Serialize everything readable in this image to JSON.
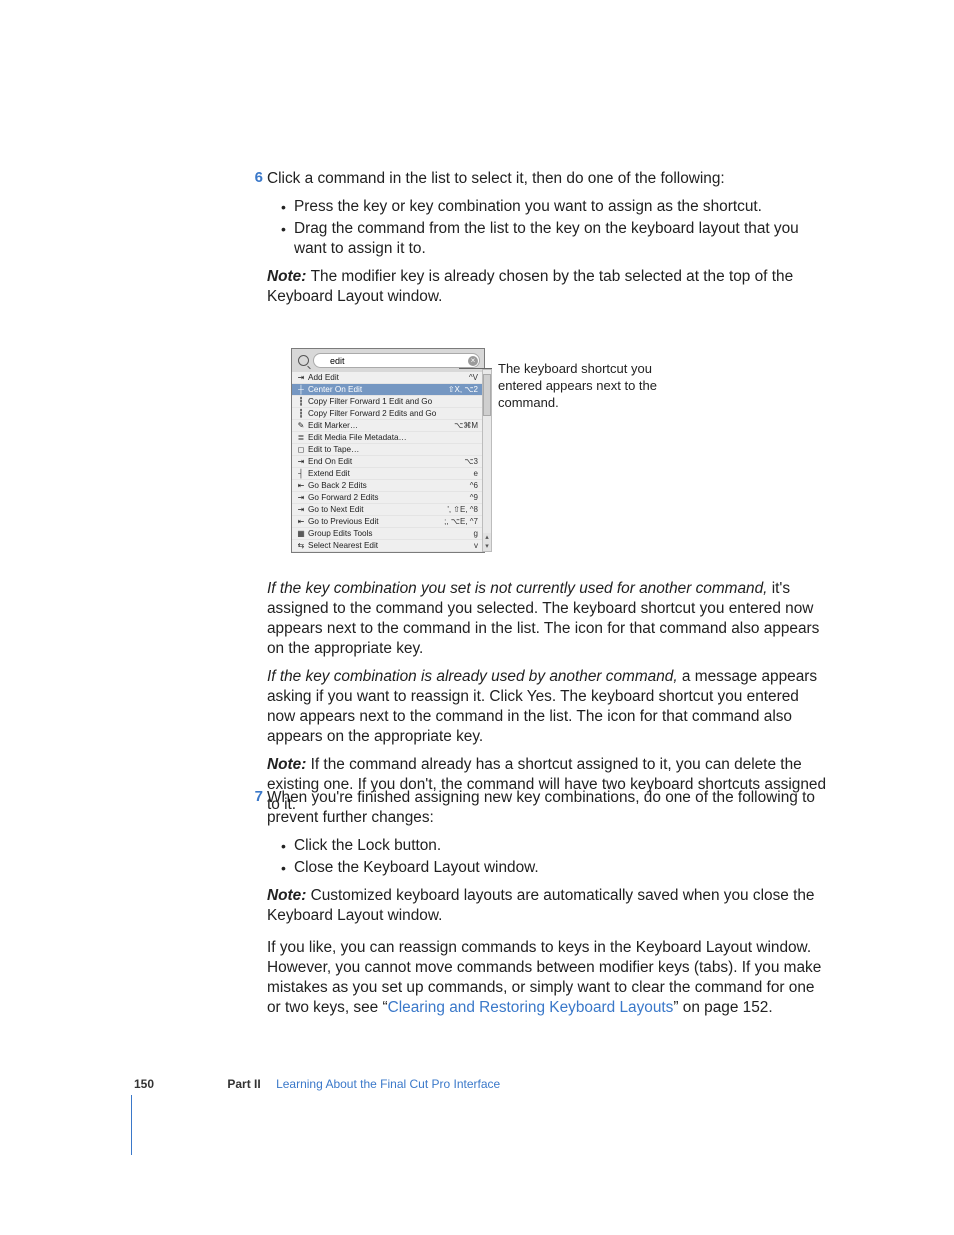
{
  "steps": {
    "s6": {
      "num": "6",
      "lead": "Click a command in the list to select it, then do one of the following:",
      "b1": "Press the key or key combination you want to assign as the shortcut.",
      "b2": "Drag the command from the list to the key on the keyboard layout that you want to assign it to.",
      "note": "The modifier key is already chosen by the tab selected at the top of the Keyboard Layout window."
    },
    "s7": {
      "num": "7",
      "lead": "When you're finished assigning new key combinations, do one of the following to prevent further changes:",
      "b1": "Click the Lock button.",
      "b2": "Close the Keyboard Layout window.",
      "note": "Customized keyboard layouts are automatically saved when you close the Keyboard Layout window."
    }
  },
  "paras": {
    "p1a": "If the key combination you set is not currently used for another command,",
    "p1b": " it's assigned to the command you selected. The keyboard shortcut you entered now appears next to the command in the list. The icon for that command also appears on the appropriate key.",
    "p2a": "If the key combination is already used by another command,",
    "p2b": " a message appears asking if you want to reassign it. Click Yes. The keyboard shortcut you entered now appears next to the command in the list. The icon for that command also appears on the appropriate key.",
    "p3": "If the command already has a shortcut assigned to it, you can delete the existing one. If you don't, the command will have two keyboard shortcuts assigned to it.",
    "p4a": "If you like, you can reassign commands to keys in the Keyboard Layout window. However, you cannot move commands between modifier keys (tabs). If you make mistakes as you set up commands, or simply want to clear the command for one or two keys, see “",
    "p4b": "Clearing and Restoring Keyboard Layouts",
    "p4c": "” on page 152."
  },
  "note_label": "Note:  ",
  "shot": {
    "search_value": "edit",
    "rows": [
      {
        "icon": "⇥",
        "label": "Add Edit",
        "sc": "^V",
        "sel": false
      },
      {
        "icon": "┼",
        "label": "Center On Edit",
        "sc": "⇧X,  ⌥2",
        "sel": true
      },
      {
        "icon": "┇",
        "label": "Copy Filter Forward 1 Edit and Go",
        "sc": "",
        "sel": false
      },
      {
        "icon": "┇",
        "label": "Copy Filter Forward 2 Edits and Go",
        "sc": "",
        "sel": false
      },
      {
        "icon": "✎",
        "label": "Edit Marker…",
        "sc": "⌥⌘M",
        "sel": false
      },
      {
        "icon": "≣",
        "label": "Edit Media File Metadata…",
        "sc": "",
        "sel": false
      },
      {
        "icon": "◻",
        "label": "Edit to Tape…",
        "sc": "",
        "sel": false
      },
      {
        "icon": "⇥",
        "label": "End On Edit",
        "sc": "⌥3",
        "sel": false
      },
      {
        "icon": "┤",
        "label": "Extend Edit",
        "sc": "e",
        "sel": false
      },
      {
        "icon": "⇤",
        "label": "Go Back 2 Edits",
        "sc": "^6",
        "sel": false
      },
      {
        "icon": "⇥",
        "label": "Go Forward 2 Edits",
        "sc": "^9",
        "sel": false
      },
      {
        "icon": "⇥",
        "label": "Go to Next Edit",
        "sc": "',  ⇧E,  ^8",
        "sel": false
      },
      {
        "icon": "⇤",
        "label": "Go to Previous Edit",
        "sc": ";,  ⌥E,  ^7",
        "sel": false
      },
      {
        "icon": "▦",
        "label": "Group Edits Tools",
        "sc": "g",
        "sel": false
      },
      {
        "icon": "⇆",
        "label": "Select Nearest Edit",
        "sc": "v",
        "sel": false
      }
    ]
  },
  "callout": "The keyboard shortcut you entered appears next to the command.",
  "footer": {
    "page_number": "150",
    "part_label": "Part II",
    "section_title": "Learning About the Final Cut Pro Interface"
  }
}
